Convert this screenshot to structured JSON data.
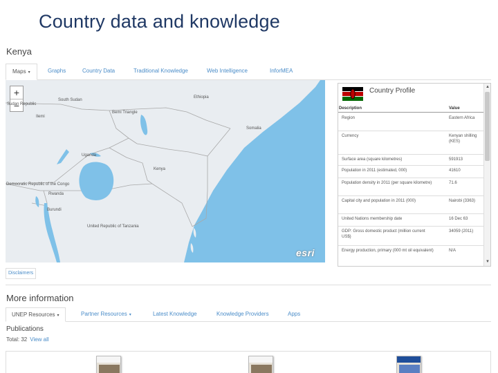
{
  "slide_title": "Country data and knowledge",
  "country": {
    "name": "Kenya"
  },
  "tabs": [
    {
      "label": "Maps",
      "caret": "▾"
    },
    {
      "label": "Graphs"
    },
    {
      "label": "Country Data"
    },
    {
      "label": "Traditional Knowledge"
    },
    {
      "label": "Web Intelligence"
    },
    {
      "label": "InforMEA"
    }
  ],
  "map": {
    "zoom_in": "+",
    "zoom_out": "−",
    "labels": {
      "south_sudan": "South Sudan",
      "sudan_republic": "Sudan Republic",
      "ethiopia": "Ethiopia",
      "ilemi": "Ilemi",
      "somalia": "Somalia",
      "uganda": "Uganda",
      "kenya": "Kenya",
      "drc": "Democratic Republic of the Congo",
      "rwanda": "Rwanda",
      "burundi": "Burundi",
      "tanzania": "United Republic of Tanzania",
      "bemi_triangle": "Bemi Triangle"
    },
    "attribution": "esri",
    "colors": {
      "water": "#7fc1e8",
      "land": "#e9edf1",
      "border": "#a8a8a8"
    }
  },
  "profile": {
    "title": "Country Profile",
    "col_description": "Description",
    "col_value": "Value",
    "rows": [
      {
        "d": "Region",
        "v": "Eastern Africa"
      },
      {
        "d": "Currency",
        "v": "Kenyan shilling (KES)"
      },
      {
        "d": "Surface area (square kilometres)",
        "v": "591913"
      },
      {
        "d": "Population in 2011 (estimated, 000)",
        "v": "41610"
      },
      {
        "d": "Population density in 2011 (per square kilometre)",
        "v": "71.6"
      },
      {
        "d": "Capital city and population in 2011 (000)",
        "v": "Nairobi (3363)"
      },
      {
        "d": "United Nations membership date",
        "v": "16 Dec 63"
      },
      {
        "d": "GDP: Gross domestic product (million current US$)",
        "v": "34059 (2011)"
      },
      {
        "d": "Energy production, primary (000 mt oil equivalent)",
        "v": "N/A"
      }
    ]
  },
  "disclaimers": "Disclaimers",
  "more_info": {
    "title": "More information",
    "tabs": [
      {
        "label": "UNEP Resources",
        "caret": "▾"
      },
      {
        "label": "Partner Resources",
        "caret": "▾"
      },
      {
        "label": "Latest Knowledge"
      },
      {
        "label": "Knowledge Providers"
      },
      {
        "label": "Apps"
      }
    ]
  },
  "publications": {
    "title": "Publications",
    "total": "Total: 32",
    "view_all": "View all"
  }
}
